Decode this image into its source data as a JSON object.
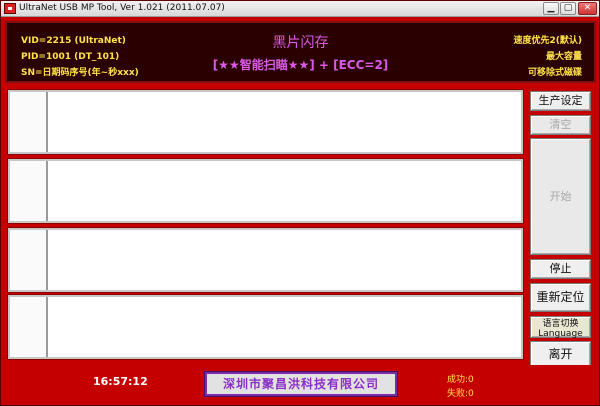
{
  "window": {
    "title": "UltraNet USB MP Tool, Ver 1.021 (2011.07.07)",
    "min_glyph": "▁",
    "max_glyph": "▢",
    "close_glyph": "✕",
    "icon": "app-icon"
  },
  "header": {
    "vid": "VID=2215 (UltraNet)",
    "pid": "PID=1001 (DT_101)",
    "sn": "SN=日期码序号(年~秒xxx)",
    "title": "黑片闪存",
    "subtitle": "[★★智能扫瞄★★] + [ECC=2]",
    "mode_speed": "速度优先2(默认)",
    "mode_capacity": "最大容量",
    "mode_removable": "可移除式磁碟"
  },
  "slots": [
    {
      "port": "",
      "info": ""
    },
    {
      "port": "",
      "info": ""
    },
    {
      "port": "",
      "info": ""
    },
    {
      "port": "",
      "info": ""
    }
  ],
  "buttons": {
    "production_settings": "生产设定",
    "clear": "清空",
    "start": "开始",
    "stop": "停止",
    "relocate": "重新定位",
    "language_cn": "语言切换",
    "language_en": "Language",
    "exit": "离开"
  },
  "status": {
    "clock": "16:57:12",
    "company": "深圳市聚昌洪科技有限公司",
    "success": "成功:0",
    "fail": "失败:0"
  },
  "colors": {
    "background": "#c50000",
    "header_bg": "#2a0000",
    "header_text": "#ffe44a",
    "title_text": "#d95ae8",
    "company_text": "#8a2fc8"
  }
}
